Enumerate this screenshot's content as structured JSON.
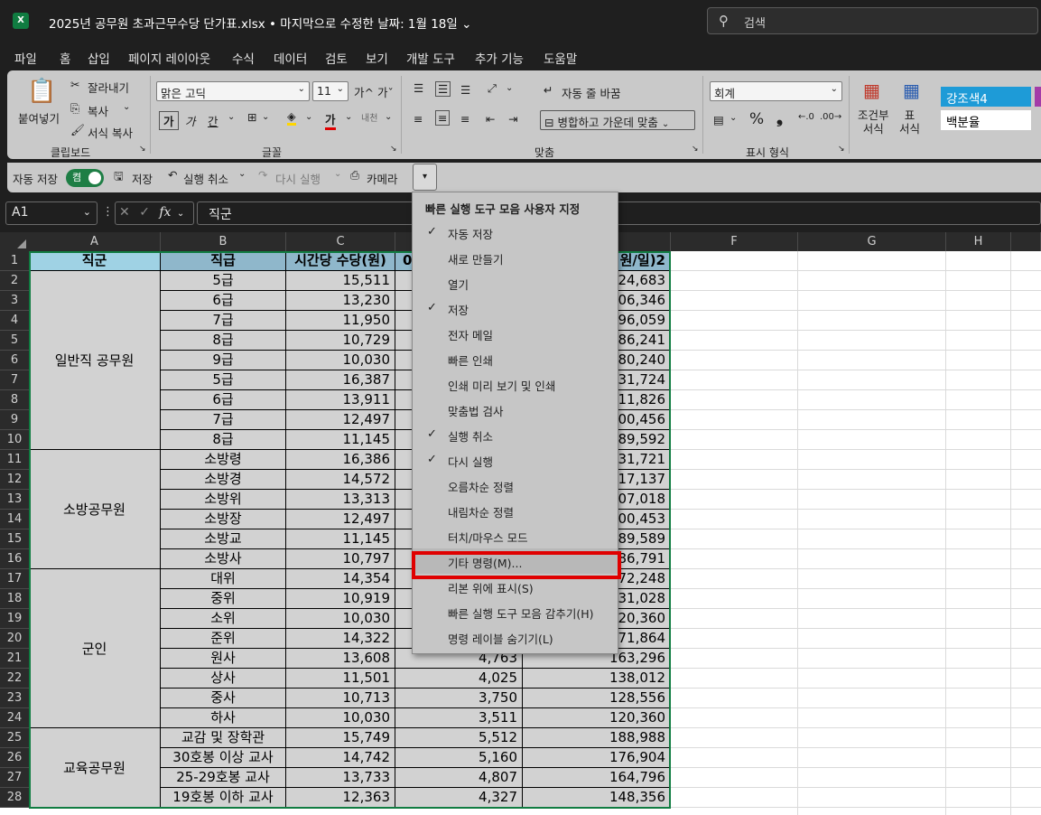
{
  "window": {
    "title": "2025년 공무원 초과근무수당 단가표.xlsx • 마지막으로 수정한 날짜: 1월 18일 ⌄",
    "app_icon_text": "X"
  },
  "search": {
    "placeholder": "검색"
  },
  "menu_tabs": [
    "파일",
    "홈",
    "삽입",
    "페이지 레이아웃",
    "수식",
    "데이터",
    "검토",
    "보기",
    "개발 도구",
    "추가 기능",
    "도움말"
  ],
  "active_tab": "홈",
  "ribbon": {
    "clipboard": {
      "paste": "붙여넣기",
      "cut": "잘라내기",
      "copy": "복사",
      "format_painter": "서식 복사",
      "label": "클립보드"
    },
    "font": {
      "name": "맑은 고딕",
      "size": "11",
      "grow": "가^",
      "shrink": "가ˇ",
      "bold": "가",
      "italic": "가",
      "underline": "간",
      "font_color": "가",
      "label": "글꼴"
    },
    "alignment": {
      "wrap": "자동 줄 바꿈",
      "merge": "병합하고 가운데 맞춤",
      "label": "맞춤"
    },
    "number": {
      "format": "회계",
      "percent": "%",
      "comma": "❟",
      "label": "표시 형식"
    },
    "styles": {
      "conditional": "조건부\n서식",
      "table": "표\n서식",
      "style1": "강조색4",
      "style2": "백분율"
    }
  },
  "qat": {
    "autosave": "자동 저장",
    "toggle": "켬",
    "save": "저장",
    "undo": "실행 취소",
    "redo": "다시 실행",
    "camera": "카메라"
  },
  "formula_bar": {
    "cell_ref": "A1",
    "fx": "fx",
    "value": "직군"
  },
  "columns": [
    "A",
    "B",
    "C",
    "",
    "",
    "F",
    "G",
    "H"
  ],
  "headers": {
    "a": "직군",
    "b": "직급",
    "c": "시간당 수당(원)",
    "d_partial": "0",
    "e_partial": "원/일)2"
  },
  "groups": [
    {
      "name": "일반직 공무원",
      "start": 2,
      "end": 10
    },
    {
      "name": "소방공무원",
      "start": 11,
      "end": 16
    },
    {
      "name": "군인",
      "start": 17,
      "end": 24
    },
    {
      "name": "교육공무원",
      "start": 25,
      "end": 28
    }
  ],
  "rows": [
    {
      "n": "1"
    },
    {
      "n": "2",
      "b": "5급",
      "c": "15,511",
      "d": "",
      "e": "124,683"
    },
    {
      "n": "3",
      "b": "6급",
      "c": "13,230",
      "d": "",
      "e": "106,346"
    },
    {
      "n": "4",
      "b": "7급",
      "c": "11,950",
      "d": "",
      "e": "96,059"
    },
    {
      "n": "5",
      "b": "8급",
      "c": "10,729",
      "d": "",
      "e": "86,241"
    },
    {
      "n": "6",
      "b": "9급",
      "c": "10,030",
      "d": "",
      "e": "80,240"
    },
    {
      "n": "7",
      "b": "5급",
      "c": "16,387",
      "d": "",
      "e": "131,724"
    },
    {
      "n": "8",
      "b": "6급",
      "c": "13,911",
      "d": "",
      "e": "111,826"
    },
    {
      "n": "9",
      "b": "7급",
      "c": "12,497",
      "d": "",
      "e": "100,456"
    },
    {
      "n": "10",
      "b": "8급",
      "c": "11,145",
      "d": "",
      "e": "89,592"
    },
    {
      "n": "11",
      "b": "소방령",
      "c": "16,386",
      "d": "",
      "e": "131,721"
    },
    {
      "n": "12",
      "b": "소방경",
      "c": "14,572",
      "d": "",
      "e": "117,137"
    },
    {
      "n": "13",
      "b": "소방위",
      "c": "13,313",
      "d": "",
      "e": "107,018"
    },
    {
      "n": "14",
      "b": "소방장",
      "c": "12,497",
      "d": "",
      "e": "100,453"
    },
    {
      "n": "15",
      "b": "소방교",
      "c": "11,145",
      "d": "",
      "e": "89,589"
    },
    {
      "n": "16",
      "b": "소방사",
      "c": "10,797",
      "d": "",
      "e": "86,791"
    },
    {
      "n": "17",
      "b": "대위",
      "c": "14,354",
      "d": "",
      "e": "172,248"
    },
    {
      "n": "18",
      "b": "중위",
      "c": "10,919",
      "d": "",
      "e": "131,028"
    },
    {
      "n": "19",
      "b": "소위",
      "c": "10,030",
      "d": "",
      "e": "120,360"
    },
    {
      "n": "20",
      "b": "준위",
      "c": "14,322",
      "d": "",
      "e": "171,864"
    },
    {
      "n": "21",
      "b": "원사",
      "c": "13,608",
      "d": "4,763",
      "e": "163,296"
    },
    {
      "n": "22",
      "b": "상사",
      "c": "11,501",
      "d": "4,025",
      "e": "138,012"
    },
    {
      "n": "23",
      "b": "중사",
      "c": "10,713",
      "d": "3,750",
      "e": "128,556"
    },
    {
      "n": "24",
      "b": "하사",
      "c": "10,030",
      "d": "3,511",
      "e": "120,360"
    },
    {
      "n": "25",
      "b": "교감 및 장학관",
      "c": "15,749",
      "d": "5,512",
      "e": "188,988"
    },
    {
      "n": "26",
      "b": "30호봉 이상 교사",
      "c": "14,742",
      "d": "5,160",
      "e": "176,904"
    },
    {
      "n": "27",
      "b": "25-29호봉 교사",
      "c": "13,733",
      "d": "4,807",
      "e": "164,796"
    },
    {
      "n": "28",
      "b": "19호봉 이하 교사",
      "c": "12,363",
      "d": "4,327",
      "e": "148,356"
    }
  ],
  "qat_menu": {
    "title": "빠른 실행 도구 모음 사용자 지정",
    "items": [
      {
        "label": "자동 저장",
        "checked": true
      },
      {
        "label": "새로 만들기",
        "checked": false
      },
      {
        "label": "열기",
        "checked": false
      },
      {
        "label": "저장",
        "checked": true
      },
      {
        "label": "전자 메일",
        "checked": false
      },
      {
        "label": "빠른 인쇄",
        "checked": false
      },
      {
        "label": "인쇄 미리 보기 및 인쇄",
        "checked": false
      },
      {
        "label": "맞춤법 검사",
        "checked": false
      },
      {
        "label": "실행 취소",
        "checked": true
      },
      {
        "label": "다시 실행",
        "checked": true
      },
      {
        "label": "오름차순 정렬",
        "checked": false
      },
      {
        "label": "내림차순 정렬",
        "checked": false
      },
      {
        "label": "터치/마우스 모드",
        "checked": false
      },
      {
        "label": "기타 명령(M)...",
        "checked": false
      },
      {
        "label": "리본 위에 표시(S)",
        "checked": false
      },
      {
        "label": "빠른 실행 도구 모음 감추기(H)",
        "checked": false
      },
      {
        "label": "명령 레이블 숨기기(L)",
        "checked": false
      }
    ],
    "highlighted": "기타 명령(M)..."
  },
  "colors": {
    "header_fill": "#9fd2e4",
    "header_fill_b": "#8fb7cb",
    "group_fill": "#d2d2d2",
    "selection": "#107c41",
    "highlight": "#e00000"
  }
}
